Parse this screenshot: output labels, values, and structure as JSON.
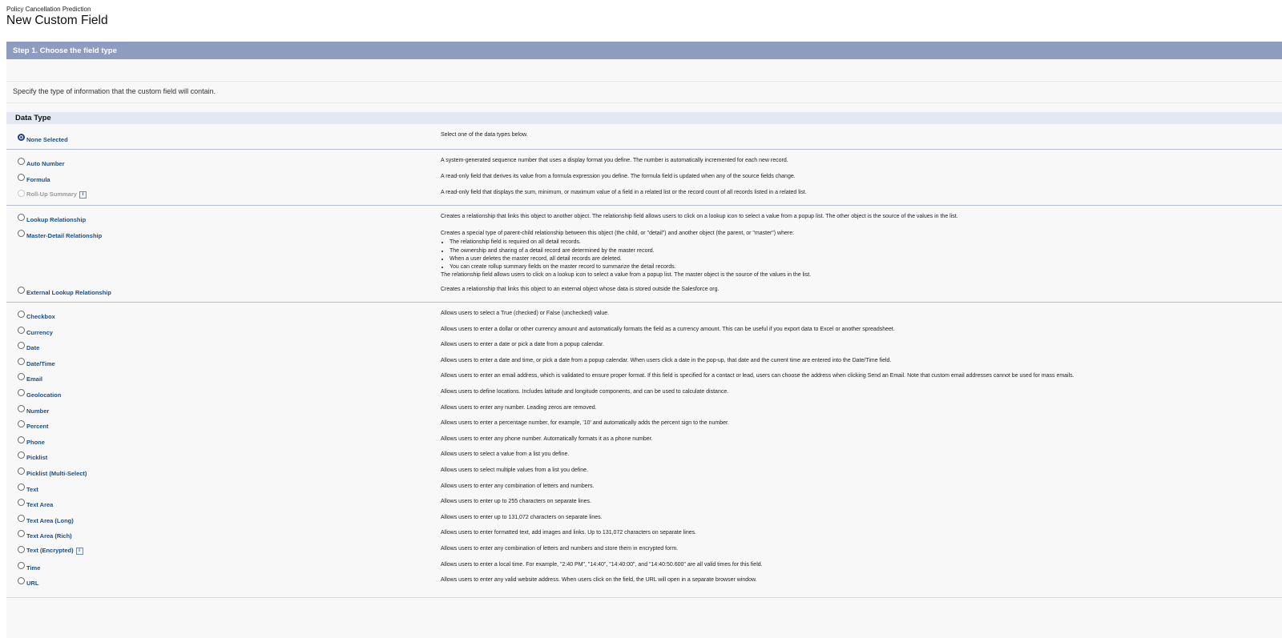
{
  "header": {
    "breadcrumb": "Policy Cancellation Prediction",
    "title": "New Custom Field"
  },
  "step": {
    "title": "Step 1. Choose the field type"
  },
  "intro": "Specify the type of information that the custom field will contain.",
  "section_title": "Data Type",
  "none_selected": {
    "label": "None Selected",
    "description": "Select one of the data types below."
  },
  "group1": [
    {
      "label": "Auto Number",
      "description": "A system-generated sequence number that uses a display format you define. The number is automatically incremented for each new record."
    },
    {
      "label": "Formula",
      "description": "A read-only field that derives its value from a formula expression you define. The formula field is updated when any of the source fields change."
    },
    {
      "label": "Roll-Up Summary",
      "description": "A read-only field that displays the sum, minimum, or maximum value of a field in a related list or the record count of all records listed in a related list."
    }
  ],
  "group2": {
    "lookup": {
      "label": "Lookup Relationship",
      "description": "Creates a relationship that links this object to another object. The relationship field allows users to click on a lookup icon to select a value from a popup list. The other object is the source of the values in the list."
    },
    "master_detail": {
      "label": "Master-Detail Relationship",
      "intro": "Creates a special type of parent-child relationship between this object (the child, or \"detail\") and another object (the parent, or \"master\") where:",
      "bullets": [
        "The relationship field is required on all detail records.",
        "The ownership and sharing of a detail record are determined by the master record.",
        "When a user deletes the master record, all detail records are deleted.",
        "You can create rollup summary fields on the master record to summarize the detail records."
      ],
      "outro": "The relationship field allows users to click on a lookup icon to select a value from a popup list. The master object is the source of the values in the list."
    },
    "external": {
      "label": "External Lookup Relationship",
      "description": "Creates a relationship that links this object to an external object whose data is stored outside the Salesforce org."
    }
  },
  "group3": [
    {
      "label": "Checkbox",
      "description": "Allows users to select a True (checked) or False (unchecked) value."
    },
    {
      "label": "Currency",
      "description": "Allows users to enter a dollar or other currency amount and automatically formats the field as a currency amount. This can be useful if you export data to Excel or another spreadsheet."
    },
    {
      "label": "Date",
      "description": "Allows users to enter a date or pick a date from a popup calendar."
    },
    {
      "label": "Date/Time",
      "description": "Allows users to enter a date and time, or pick a date from a popup calendar. When users click a date in the pop-up, that date and the current time are entered into the Date/Time field."
    },
    {
      "label": "Email",
      "description": "Allows users to enter an email address, which is validated to ensure proper format. If this field is specified for a contact or lead, users can choose the address when clicking Send an Email. Note that custom email addresses cannot be used for mass emails."
    },
    {
      "label": "Geolocation",
      "description": "Allows users to define locations. Includes latitude and longitude components, and can be used to calculate distance."
    },
    {
      "label": "Number",
      "description": "Allows users to enter any number. Leading zeros are removed."
    },
    {
      "label": "Percent",
      "description": "Allows users to enter a percentage number, for example, '10' and automatically adds the percent sign to the number."
    },
    {
      "label": "Phone",
      "description": "Allows users to enter any phone number. Automatically formats it as a phone number."
    },
    {
      "label": "Picklist",
      "description": "Allows users to select a value from a list you define."
    },
    {
      "label": "Picklist (Multi-Select)",
      "description": "Allows users to select multiple values from a list you define."
    },
    {
      "label": "Text",
      "description": "Allows users to enter any combination of letters and numbers."
    },
    {
      "label": "Text Area",
      "description": "Allows users to enter up to 255 characters on separate lines."
    },
    {
      "label": "Text Area (Long)",
      "description": "Allows users to enter up to 131,072 characters on separate lines."
    },
    {
      "label": "Text Area (Rich)",
      "description": "Allows users to enter formatted text, add images and links. Up to 131,072 characters on separate lines."
    },
    {
      "label": "Text (Encrypted)",
      "description": "Allows users to enter any combination of letters and numbers and store them in encrypted form."
    },
    {
      "label": "Time",
      "description": "Allows users to enter a local time. For example, \"2:40 PM\", \"14:40\", \"14:40:00\", and \"14:40:50.600\" are all valid times for this field."
    },
    {
      "label": "URL",
      "description": "Allows users to enter any valid website address. When users click on the field, the URL will open in a separate browser window."
    }
  ],
  "info_icon_glyph": "i"
}
